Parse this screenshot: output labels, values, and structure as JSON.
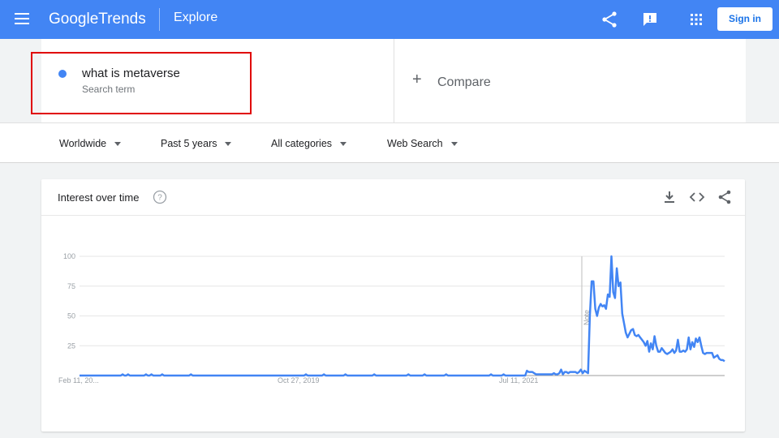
{
  "header": {
    "logo_google": "Google",
    "logo_trends": "Trends",
    "section": "Explore",
    "sign_in_label": "Sign in",
    "icons": [
      "menu-icon",
      "share-icon",
      "feedback-icon",
      "apps-grid-icon"
    ],
    "bar_color": "#4285f4"
  },
  "search_term": {
    "name": "what is metaverse",
    "subtitle": "Search term",
    "color": "#4285f4",
    "highlight_color": "#e00000"
  },
  "compare": {
    "label": "Compare",
    "icon": "plus-icon"
  },
  "filters": [
    {
      "label": "Worldwide"
    },
    {
      "label": "Past 5 years"
    },
    {
      "label": "All categories"
    },
    {
      "label": "Web Search"
    }
  ],
  "interest_card": {
    "title": "Interest over time",
    "actions": [
      "download-icon",
      "embed-code-icon",
      "share-icon"
    ],
    "note_label": "Note"
  },
  "chart_data": {
    "type": "line",
    "y_ticks": [
      100,
      75,
      50,
      25
    ],
    "ylim": [
      0,
      100
    ],
    "x_tick_labels": [
      "Feb 11, 20...",
      "Oct 27, 2019",
      "Jul 11, 2021"
    ],
    "series": [
      {
        "color": "#4285f4",
        "values": [
          0,
          0,
          0,
          0,
          0,
          0,
          0,
          0,
          0,
          0,
          0,
          0,
          0,
          0,
          0,
          0,
          0,
          0,
          0,
          0,
          0,
          0,
          0,
          0,
          1,
          0,
          0,
          1,
          0,
          0,
          0,
          0,
          0,
          0,
          0,
          0,
          0,
          1,
          0,
          0,
          1,
          0,
          0,
          0,
          0,
          0,
          1,
          0,
          0,
          0,
          0,
          0,
          0,
          0,
          0,
          0,
          0,
          0,
          0,
          0,
          0,
          0,
          1,
          0,
          0,
          0,
          0,
          0,
          0,
          0,
          0,
          0,
          0,
          0,
          0,
          0,
          0,
          0,
          0,
          0,
          0,
          0,
          0,
          0,
          0,
          0,
          0,
          0,
          0,
          0,
          0,
          0,
          0,
          0,
          0,
          0,
          0,
          0,
          0,
          0,
          0,
          0,
          0,
          0,
          0,
          0,
          0,
          0,
          0,
          0,
          0,
          0,
          0,
          0,
          0,
          0,
          0,
          0,
          0,
          0,
          0,
          0,
          0,
          0,
          0,
          0,
          1,
          0,
          0,
          0,
          0,
          0,
          0,
          0,
          0,
          0,
          1,
          0,
          0,
          0,
          0,
          0,
          0,
          0,
          0,
          0,
          0,
          0,
          1,
          0,
          0,
          0,
          0,
          0,
          0,
          0,
          0,
          0,
          0,
          0,
          0,
          0,
          0,
          0,
          1,
          0,
          0,
          0,
          0,
          0,
          0,
          0,
          0,
          0,
          0,
          0,
          0,
          0,
          0,
          0,
          0,
          0,
          0,
          1,
          0,
          0,
          0,
          0,
          0,
          0,
          0,
          0,
          1,
          0,
          0,
          0,
          0,
          0,
          0,
          0,
          0,
          0,
          0,
          0,
          1,
          0,
          0,
          0,
          0,
          0,
          0,
          0,
          0,
          0,
          0,
          0,
          0,
          0,
          0,
          0,
          0,
          0,
          0,
          0,
          0,
          0,
          0,
          0,
          0,
          1,
          0,
          0,
          0,
          0,
          0,
          0,
          1,
          0,
          0,
          0,
          0,
          0,
          0,
          0,
          0,
          0,
          0,
          0,
          0,
          4,
          3,
          3,
          3,
          2,
          1,
          1,
          1,
          1,
          1,
          1,
          1,
          1,
          1,
          1,
          2,
          1,
          1,
          2,
          5,
          1,
          3,
          3,
          2,
          3,
          3,
          3,
          3,
          2,
          3,
          5,
          2,
          4,
          3,
          2,
          50,
          79,
          79,
          56,
          50,
          57,
          60,
          58,
          59,
          56,
          68,
          66,
          100,
          70,
          65,
          90,
          75,
          78,
          52,
          44,
          36,
          32,
          35,
          38,
          39,
          34,
          33,
          34,
          32,
          30,
          28,
          25,
          29,
          20,
          27,
          22,
          33,
          25,
          20,
          20,
          23,
          21,
          19,
          18,
          19,
          20,
          22,
          19,
          21,
          30,
          20,
          20,
          21,
          20,
          22,
          32,
          22,
          28,
          24,
          31,
          28,
          32,
          25,
          19,
          18,
          19,
          19,
          19,
          19,
          15,
          16,
          17,
          14,
          13,
          13,
          12
        ]
      }
    ]
  }
}
